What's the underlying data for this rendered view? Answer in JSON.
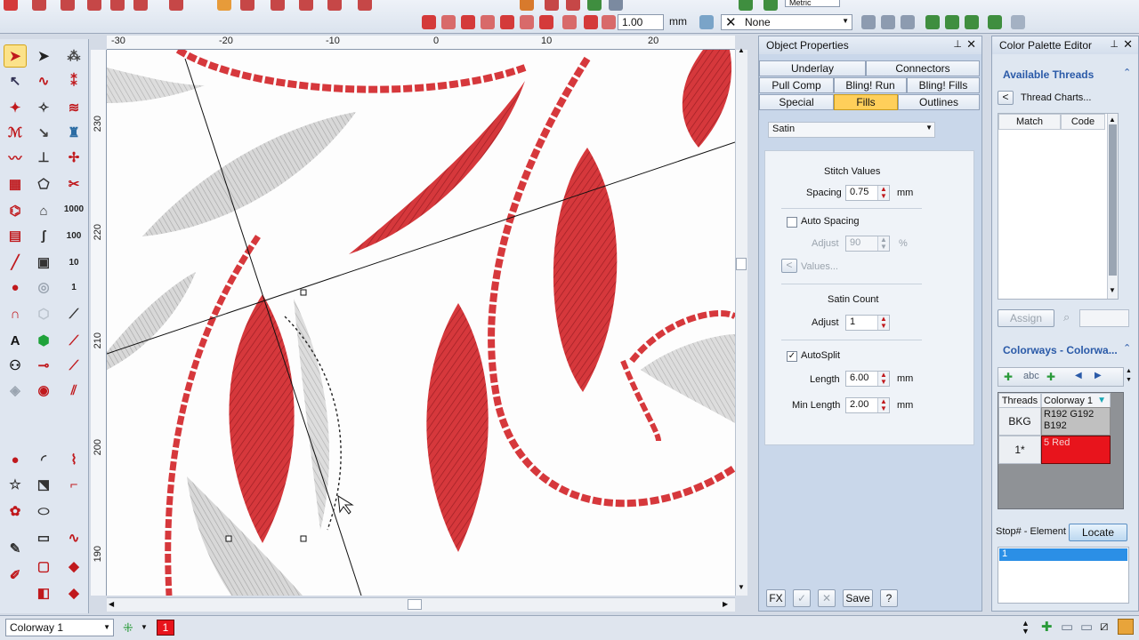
{
  "toolbar": {
    "zoom_value": "1.00",
    "zoom_unit": "mm",
    "overlay_select_value": "None",
    "metric_label": "Metric"
  },
  "ruler": {
    "top": [
      "-30",
      "-20",
      "-10",
      "0",
      "10",
      "20"
    ],
    "left": [
      "230",
      "220",
      "210",
      "200",
      "190"
    ]
  },
  "tools_left": {
    "items": [
      "1000",
      "100",
      "10",
      "1"
    ]
  },
  "object_properties": {
    "title": "Object Properties",
    "tabs_row1": [
      "Underlay",
      "Connectors"
    ],
    "tabs_row2": [
      "Pull Comp",
      "Bling! Run",
      "Bling! Fills"
    ],
    "tabs_row3": [
      "Special",
      "Fills",
      "Outlines"
    ],
    "fill_type": "Satin",
    "stitch_values_label": "Stitch Values",
    "spacing_label": "Spacing",
    "spacing_value": "0.75",
    "spacing_unit": "mm",
    "auto_spacing_label": "Auto Spacing",
    "adjust_label": "Adjust",
    "adjust_value": "90",
    "adjust_unit": "%",
    "values_label": "Values...",
    "satin_count_label": "Satin Count",
    "satin_adjust_label": "Adjust",
    "satin_adjust_value": "1",
    "autosplit_label": "AutoSplit",
    "length_label": "Length",
    "length_value": "6.00",
    "length_unit": "mm",
    "min_length_label": "Min Length",
    "min_length_value": "2.00",
    "min_length_unit": "mm",
    "fx_label": "FX",
    "save_label": "Save",
    "help_label": "?"
  },
  "color_palette": {
    "title": "Color Palette Editor",
    "available_threads": "Available Threads",
    "thread_charts": "Thread Charts...",
    "col_match": "Match",
    "col_code": "Code",
    "assign_label": "Assign",
    "colorways_title": "Colorways - Colorwa...",
    "threads_header": "Threads",
    "colorway_header": "Colorway 1",
    "rows": [
      {
        "label": "BKG",
        "value": "R192 G192 B192",
        "color": "#c0c0c0"
      },
      {
        "label": "1*",
        "value": "5 Red",
        "color": "#e8141c"
      }
    ],
    "stop_element_label": "Stop# - Element",
    "locate_label": "Locate",
    "list_items": [
      "1"
    ]
  },
  "statusbar": {
    "colorway": "Colorway 1",
    "color_index": "1"
  },
  "colors": {
    "accent": "#2a5aa8",
    "thread_red": "#d6383c",
    "tab_active": "#ffcf5a"
  }
}
